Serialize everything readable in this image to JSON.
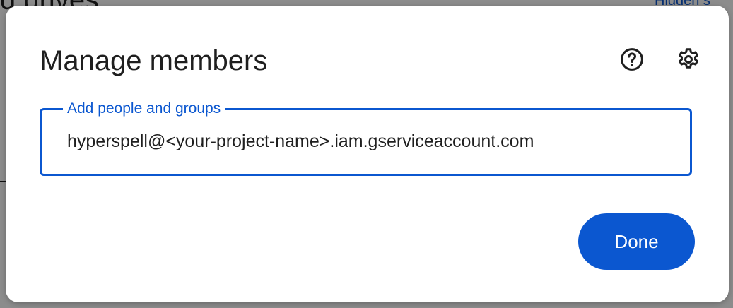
{
  "background": {
    "title_fragment": "d drives",
    "link_fragment": "Hidden s",
    "side_fragment": "l"
  },
  "dialog": {
    "title": "Manage members",
    "help_icon": "help-circle-icon",
    "settings_icon": "gear-icon",
    "field": {
      "label": "Add people and groups",
      "value": "hyperspell@<your-project-name>.iam.gserviceaccount.com"
    },
    "done_label": "Done"
  },
  "colors": {
    "accent": "#0b57d0",
    "text": "#1f1f1f",
    "surface": "#ffffff"
  }
}
